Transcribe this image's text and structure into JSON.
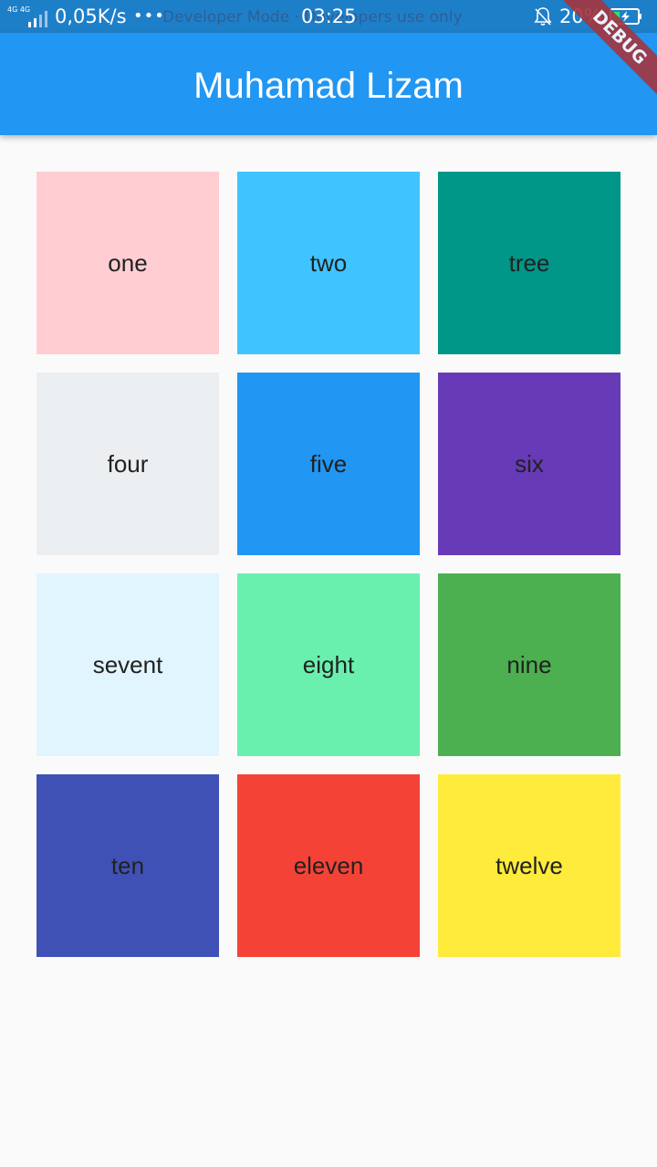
{
  "status_bar": {
    "network_type": "4G 4G",
    "speed": "0,05K/s",
    "more": "•••",
    "notice": "Developer Mode · Developers use only",
    "time": "03:25",
    "battery_percent": "20%",
    "icons": [
      "signal-icon",
      "bell-muted-icon",
      "battery-charging-icon"
    ]
  },
  "app_bar": {
    "title": "Muhamad Lizam",
    "color": "#2196f3"
  },
  "debug_banner": {
    "label": "DEBUG",
    "color": "#a4353f"
  },
  "tiles": [
    {
      "label": "one",
      "color": "#ffcdd2"
    },
    {
      "label": "two",
      "color": "#40c4ff"
    },
    {
      "label": "tree",
      "color": "#009688"
    },
    {
      "label": "four",
      "color": "#eceff1"
    },
    {
      "label": "five",
      "color": "#2196f3"
    },
    {
      "label": "six",
      "color": "#673ab7"
    },
    {
      "label": "sevent",
      "color": "#e1f5fe"
    },
    {
      "label": "eight",
      "color": "#69f0ae"
    },
    {
      "label": "nine",
      "color": "#4caf50"
    },
    {
      "label": "ten",
      "color": "#3f51b5"
    },
    {
      "label": "eleven",
      "color": "#f44336"
    },
    {
      "label": "twelve",
      "color": "#ffeb3b"
    }
  ]
}
